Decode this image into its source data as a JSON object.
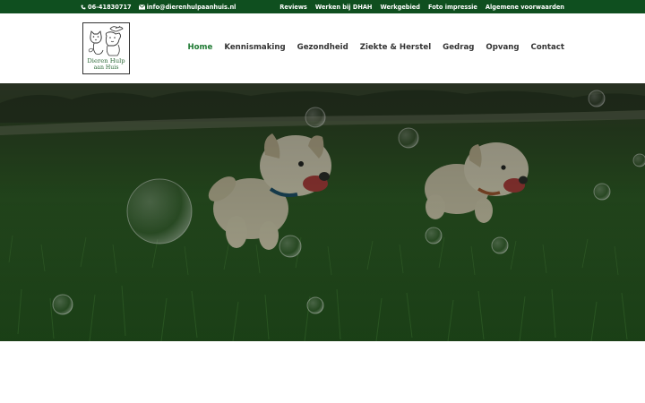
{
  "top_bar": {
    "phone": "06-41830717",
    "email": "info@dierenhulpaanhuis.nl",
    "links": [
      {
        "label": "Reviews"
      },
      {
        "label": "Werken bij DHAH"
      },
      {
        "label": "Werkgebied"
      },
      {
        "label": "Foto impressie"
      },
      {
        "label": "Algemene voorwaarden"
      }
    ]
  },
  "logo": {
    "line1": "Dieren Hulp",
    "line2": "aan Huis"
  },
  "main_nav": {
    "items": [
      {
        "label": "Home",
        "active": true
      },
      {
        "label": "Kennismaking"
      },
      {
        "label": "Gezondheid"
      },
      {
        "label": "Ziekte & Herstel"
      },
      {
        "label": "Gedrag"
      },
      {
        "label": "Opvang"
      },
      {
        "label": "Contact"
      }
    ]
  },
  "hero": {
    "scene": "puppies-running-on-grass-with-bubbles"
  },
  "colors": {
    "top_bar": "#0f4f1f",
    "nav_active": "#1f7a33",
    "nav_text": "#333333"
  }
}
